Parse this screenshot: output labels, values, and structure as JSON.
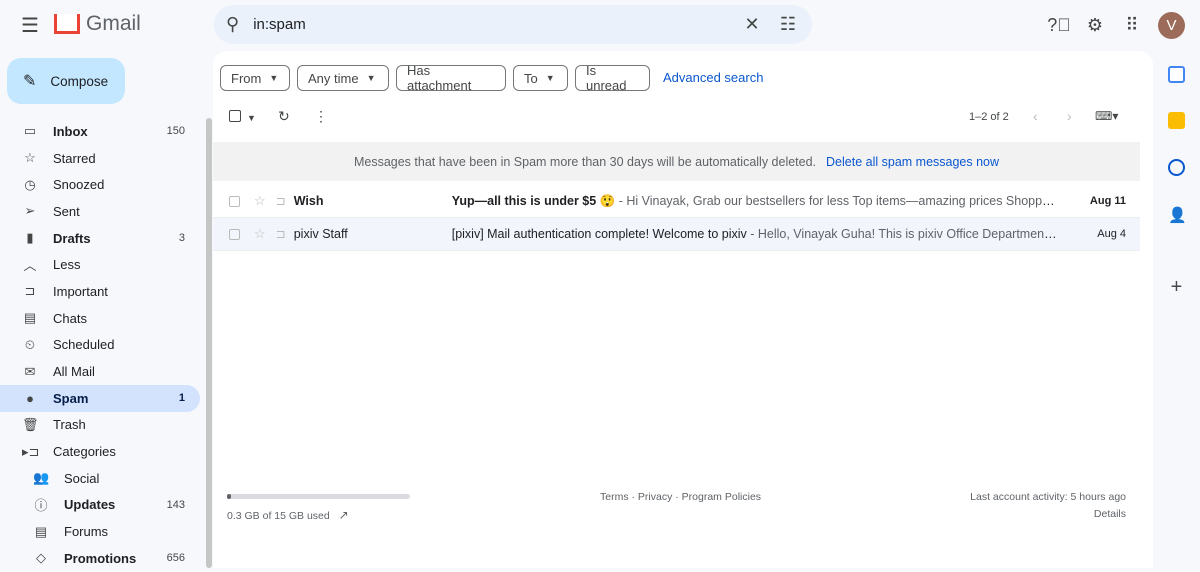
{
  "header": {
    "app": "Gmail",
    "search_value": "in:spam",
    "avatar_letter": "V"
  },
  "compose": "Compose",
  "nav": [
    {
      "icon": "inbox-icon",
      "glyph": "▭",
      "label": "Inbox",
      "count": "150",
      "bold": true
    },
    {
      "icon": "star-icon",
      "glyph": "☆",
      "label": "Starred",
      "count": ""
    },
    {
      "icon": "clock-icon",
      "glyph": "◷",
      "label": "Snoozed",
      "count": ""
    },
    {
      "icon": "send-icon",
      "glyph": "➢",
      "label": "Sent",
      "count": ""
    },
    {
      "icon": "draft-icon",
      "glyph": "▮",
      "label": "Drafts",
      "count": "3",
      "bold": true
    },
    {
      "icon": "chevron-up-icon",
      "glyph": "︿",
      "label": "Less",
      "count": ""
    },
    {
      "icon": "important-icon",
      "glyph": "⊐",
      "label": "Important",
      "count": ""
    },
    {
      "icon": "chat-icon",
      "glyph": "▤",
      "label": "Chats",
      "count": ""
    },
    {
      "icon": "scheduled-icon",
      "glyph": "⏲",
      "label": "Scheduled",
      "count": ""
    },
    {
      "icon": "all-mail-icon",
      "glyph": "✉",
      "label": "All Mail",
      "count": ""
    },
    {
      "icon": "spam-icon",
      "glyph": "●",
      "label": "Spam",
      "count": "1",
      "active": true
    },
    {
      "icon": "trash-icon",
      "glyph": "🗑",
      "label": "Trash",
      "count": ""
    },
    {
      "icon": "label-icon",
      "glyph": "▸⊐",
      "label": "Categories",
      "count": ""
    },
    {
      "icon": "social-icon",
      "glyph": "👥",
      "label": "Social",
      "count": "",
      "sub": true
    },
    {
      "icon": "info-icon",
      "glyph": "ⓘ",
      "label": "Updates",
      "count": "143",
      "sub": true,
      "bold": true
    },
    {
      "icon": "forum-icon",
      "glyph": "▤",
      "label": "Forums",
      "count": "",
      "sub": true
    },
    {
      "icon": "tag-icon",
      "glyph": "◇",
      "label": "Promotions",
      "count": "656",
      "sub": true,
      "bold": true
    }
  ],
  "filters": [
    "From",
    "Any time",
    "Has attachment",
    "To",
    "Is unread"
  ],
  "advanced_search": "Advanced search",
  "pagination": "1–2 of 2",
  "banner": {
    "text": "Messages that have been in Spam more than 30 days will be automatically deleted.",
    "action": "Delete all spam messages now"
  },
  "emails": [
    {
      "sender": "Wish",
      "subject": "Yup—all this is under $5 😲",
      "preview": " - Hi Vinayak, Grab our bestsellers for less Top items—amazing prices Shopper ...",
      "date": "Aug 11",
      "unread": true
    },
    {
      "sender": "pixiv Staff",
      "subject": "[pixiv] Mail authentication complete! Welcome to pixiv",
      "preview": " - Hello, Vinayak Guha! This is pixiv Office Department....",
      "date": "Aug 4",
      "unread": false
    }
  ],
  "footer": {
    "storage": "0.3 GB of 15 GB used",
    "storage_fraction": 0.02,
    "links": "Terms · Privacy · Program Policies",
    "activity": "Last account activity: 5 hours ago",
    "details": "Details"
  }
}
